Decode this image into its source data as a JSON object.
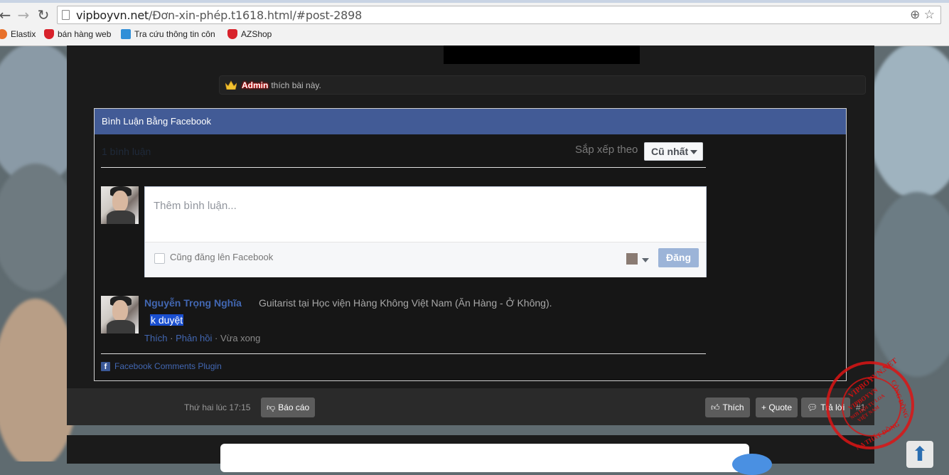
{
  "browser": {
    "url_domain": "vipboyvn.net",
    "url_path": "/Đơn-xin-phép.t1618.html/#post-2898",
    "back_icon": "back-arrow-icon",
    "forward_icon": "forward-arrow-icon",
    "reload_icon": "reload-icon",
    "zoom_icon": "zoom-icon",
    "star_icon": "star-icon",
    "bookmarks": [
      {
        "label": "Elastix",
        "color": "#e8702a"
      },
      {
        "label": "bán hàng web",
        "color": "#d8222b"
      },
      {
        "label": "Tra cứu thông tin côn",
        "color": "#2f8fd8"
      },
      {
        "label": "AZShop",
        "color": "#d8222b"
      }
    ]
  },
  "likes": {
    "user": "Admin",
    "text": "thích bài này."
  },
  "facebook": {
    "header": "Bình Luận Bằng Facebook",
    "count": "1 bình luận",
    "sort_label": "Sắp xếp theo",
    "sort_value": "Cũ nhất",
    "composer_placeholder": "Thêm bình luận...",
    "also_post_label": "Cũng đăng lên Facebook",
    "post_button": "Đăng",
    "comment": {
      "author": "Nguyễn Trọng Nghĩa",
      "role": "Guitarist tại Học viện Hàng Không Việt Nam (Ăn Hàng - Ở Không).",
      "text": "k duyệt",
      "like": "Thích",
      "reply": "Phản hồi",
      "time": "Vừa xong",
      "sep": " · "
    },
    "plugin_label": "Facebook Comments Plugin",
    "colors": {
      "header": "#425b96",
      "link": "#4267b2"
    }
  },
  "post_bar": {
    "date": "Thứ hai lúc 17:15",
    "report": "Báo cáo",
    "like": "Thích",
    "quote": "+ Quote",
    "reply": "Trả lời",
    "post_number": "#1"
  },
  "stamp": {
    "outer": "VIPBOYVN.NET",
    "right": "CỘNG ĐỒNG",
    "bottom": "NA THẤT ĐỒNG",
    "center1": "VIPBOYVN",
    "center2": "NƠI HỘI TỤ LOA",
    "center3": "VIỆT NAM"
  }
}
